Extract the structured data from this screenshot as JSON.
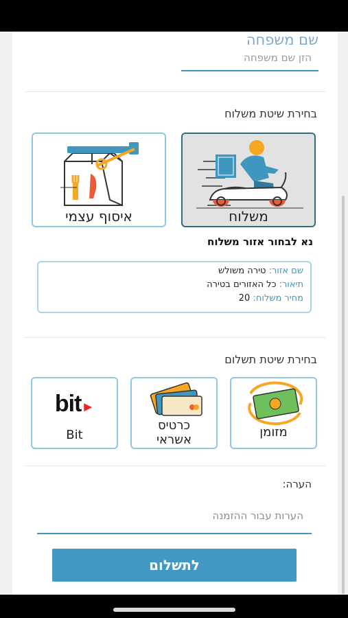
{
  "last_name": {
    "label": "שם משפחה",
    "placeholder": "הזן שם משפחה"
  },
  "shipping": {
    "title": "בחירת שיטת משלוח",
    "options": [
      {
        "label": "משלוח",
        "icon": "scooter-delivery-icon",
        "selected": true
      },
      {
        "label": "איסוף עצמי",
        "icon": "takeaway-bag-icon",
        "selected": false
      }
    ],
    "zone_prompt": "נא לבחור אזור משלוח",
    "zone": {
      "name_key": "שם אזור:",
      "name_value": "טירה משולש",
      "desc_key": "תיאור:",
      "desc_value": "כל האזורים בטירה",
      "price_key": "מחיר משלוח:",
      "price_value": "20"
    }
  },
  "payment": {
    "title": "בחירת שיטת תשלום",
    "options": [
      {
        "label": "מזומן",
        "icon": "cash-icon"
      },
      {
        "label": "כרטיס אשראי",
        "line1": "כרטיס",
        "line2": "אשראי",
        "icon": "credit-card-icon"
      },
      {
        "label": "Bit",
        "icon": "bit-logo-icon",
        "logo_text": "bit"
      }
    ]
  },
  "note": {
    "label": "הערה:",
    "placeholder": "הערות עבור ההזמנה"
  },
  "submit_label": "לתשלום",
  "colors": {
    "accent": "#4198c3",
    "tile_border": "#8fc6e4",
    "selected_border": "#2f6d82",
    "orange": "#f5a623",
    "bit_red": "#e8262f"
  }
}
